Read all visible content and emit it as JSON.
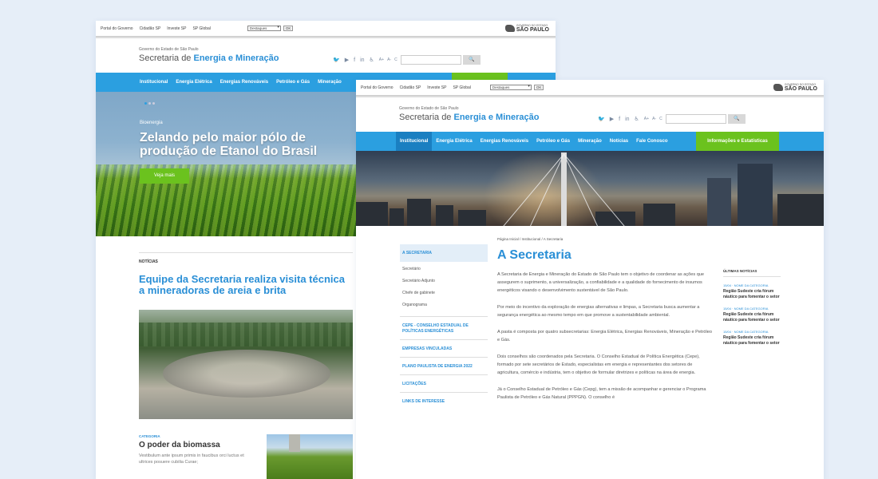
{
  "gov_bar": {
    "links": [
      "Portal do Governo",
      "Cidadão SP",
      "Investe SP",
      "SP Global"
    ],
    "select_value": "Destaques",
    "ok_label": "OK",
    "logo_line1": "GOVERNO DO ESTADO",
    "logo_line2": "SÃO PAULO"
  },
  "header": {
    "kicker": "Governo do Estado de São Paulo",
    "title_prefix": "Secretaria de ",
    "title_emphasis": "Energia e Mineração",
    "accessibility": [
      "A+",
      "A-",
      "C"
    ],
    "search_button": "🔍"
  },
  "shotA": {
    "nav": [
      "Institucional",
      "Energia Elétrica",
      "Energias Renováveis",
      "Petróleo e Gás",
      "Mineração"
    ],
    "hero": {
      "category": "Bioenergia",
      "headline": "Zelando pelo maior pólo de produção de Etanol do Brasil",
      "button": "Veja mais"
    },
    "news": {
      "section": "NOTÍCIAS",
      "title": "Equipe da Secretaria realiza visita técnica a mineradoras de areia e brita"
    },
    "bio": {
      "category": "CATEGORIA",
      "title": "O poder da biomassa",
      "description": "Vestibulum ante ipsum primis in faucibus orci luctus et ultrices posuere cubilia Curae;"
    }
  },
  "shotB": {
    "nav": [
      "Institucional",
      "Energia Elétrica",
      "Energias Renováveis",
      "Petróleo e Gás",
      "Mineração",
      "Notícias",
      "Fale Conosco"
    ],
    "nav_highlight": "Informações e Estatísticas",
    "breadcrumb": "Página Inicial  /  Institucional  /  A Secretaria",
    "sidebar": {
      "selected": "A SECRETARIA",
      "subitems": [
        "Secretário",
        "Secretário Adjunto",
        "Chefe de gabinete",
        "Organograma"
      ],
      "links": [
        "CEPE - CONSELHO ESTADUAL DE POLÍTICAS ENERGÉTICAS",
        "EMPRESAS VINCULADAS",
        "PLANO PAULISTA DE ENERGIA 2022",
        "LICITAÇÕES",
        "LINKS DE INTERESSE"
      ]
    },
    "main": {
      "title": "A Secretaria",
      "paragraphs": [
        "A Secretaria de Energia e Mineração do Estado de São Paulo tem o objetivo de coordenar as ações que assegurem o suprimento, a universalização, a confiabilidade e a qualidade do fornecimento de insumos energéticos visando o desenvolvimento sustentável de São Paulo.",
        "Por meio do incentivo da exploração de energias alternativas e limpas, a Secretaria busca aumentar a segurança energética ao mesmo tempo em que promove a sustentabilidade ambiental.",
        "A pasta é composta por quatro subsecretarias: Energia Elétrica, Energias Renováveis, Mineração e Petróleo e Gás.",
        "Dois conselhos são coordenados pela Secretaria. O Conselho Estadual de Política Energética (Cepe), formado por sete secretários de Estado, especialistas em energia e representantes dos setores de agricultura, comércio e indústria, tem o objetivo de formular diretrizes e políticas na área de energia.",
        "Já o Conselho Estadual de Petróleo e Gás (Cepg), tem a missão de acompanhar e gerenciar o Programa Paulista de Petróleo e Gás Natural (PPPGN). O conselho é"
      ]
    },
    "latest": {
      "heading": "ÚLTIMAS NOTÍCIAS",
      "items": [
        {
          "category": "15/04 · NOME DA CATEGORIA",
          "title": "Região Sudeste cria fórum náutico para fomentar o setor"
        },
        {
          "category": "15/04 · NOME DA CATEGORIA",
          "title": "Região Sudeste cria fórum náutico para fomentar o setor"
        },
        {
          "category": "15/04 · NOME DA CATEGORIA",
          "title": "Região Sudeste cria fórum náutico para fomentar o setor"
        }
      ]
    }
  },
  "colors": {
    "brand_blue": "#2b9fe0",
    "accent_green": "#6bc21e",
    "link_blue": "#2a8fd6"
  }
}
